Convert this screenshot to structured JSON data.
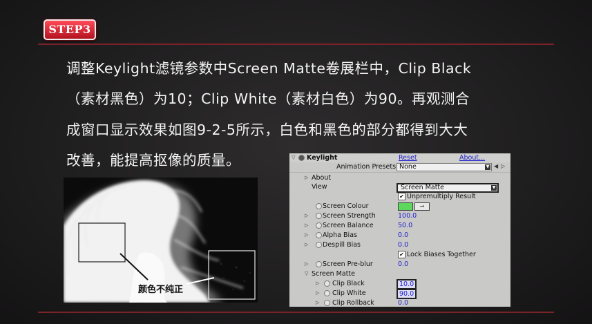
{
  "badge": {
    "label": "STEP3"
  },
  "paragraph": {
    "line1": "调整Keylight滤镜参数中Screen Matte卷展栏中，Clip Black",
    "line2": "（素材黑色）为10；Clip White（素材白色）为90。再观测合",
    "line3": "成窗口显示效果如图9-2-5所示，白色和黑色的部分都得到大大",
    "line4": "改善，能提高抠像的质量。"
  },
  "matte_image": {
    "callout": "颜色不纯正"
  },
  "panel": {
    "effect_name": "Keylight",
    "reset": "Reset",
    "about_link": "About...",
    "presets_label": "Animation Presets:",
    "presets_value": "None",
    "rows": {
      "about": "About",
      "view": "View",
      "view_value": "Screen Matte",
      "unpremultiply": "Unpremultiply Result",
      "screen_colour": "Screen Colour",
      "screen_strength": "Screen Strength",
      "screen_strength_value": "100.0",
      "screen_balance": "Screen Balance",
      "screen_balance_value": "50.0",
      "alpha_bias": "Alpha Bias",
      "alpha_bias_value": "0.0",
      "despill_bias": "Despill Bias",
      "despill_bias_value": "0.0",
      "lock_biases": "Lock Biases Together",
      "screen_preblur": "Screen Pre-blur",
      "screen_preblur_value": "0.0",
      "screen_matte": "Screen Matte",
      "clip_black": "Clip Black",
      "clip_black_value": "10.0",
      "clip_white": "Clip White",
      "clip_white_value": "90.0",
      "clip_rollback": "Clip Rollback",
      "clip_rollback_value": "0.0"
    },
    "colors": {
      "screen_colour_swatch": "#5cd95c",
      "value_blue": "#2222cc"
    }
  }
}
